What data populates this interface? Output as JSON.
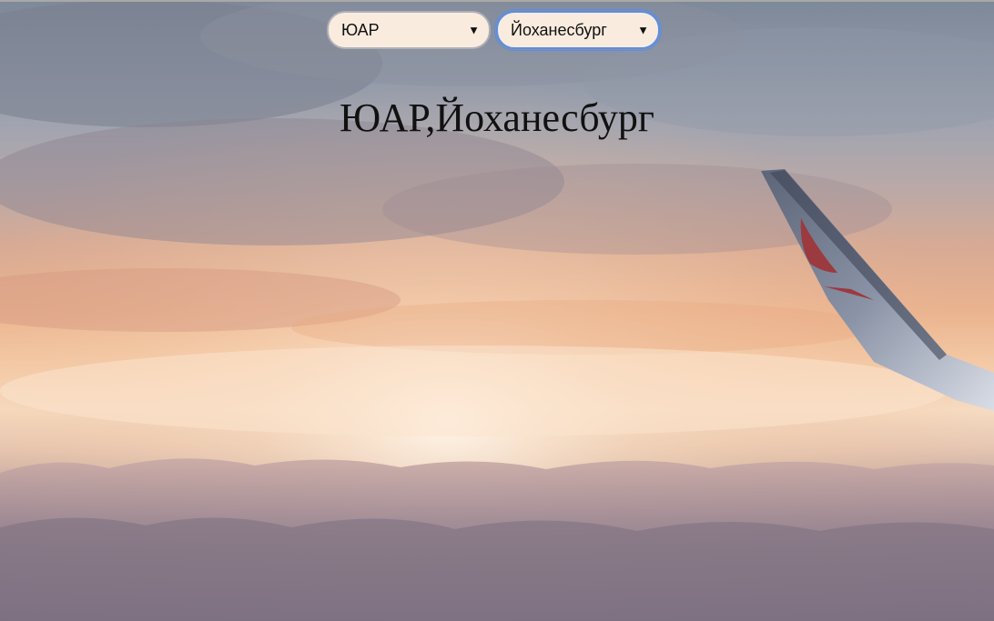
{
  "country_select": {
    "selected": "ЮАР",
    "arrow": "▼"
  },
  "city_select": {
    "selected": "Йоханесбург",
    "arrow": "▼"
  },
  "heading": "ЮАР,Йоханесбург",
  "colors": {
    "select_background": "#f9ecdf",
    "focus_border": "#5a8ee6",
    "text": "#111111"
  },
  "background_image": "sky-sunset-clouds-with-airplane-wing"
}
